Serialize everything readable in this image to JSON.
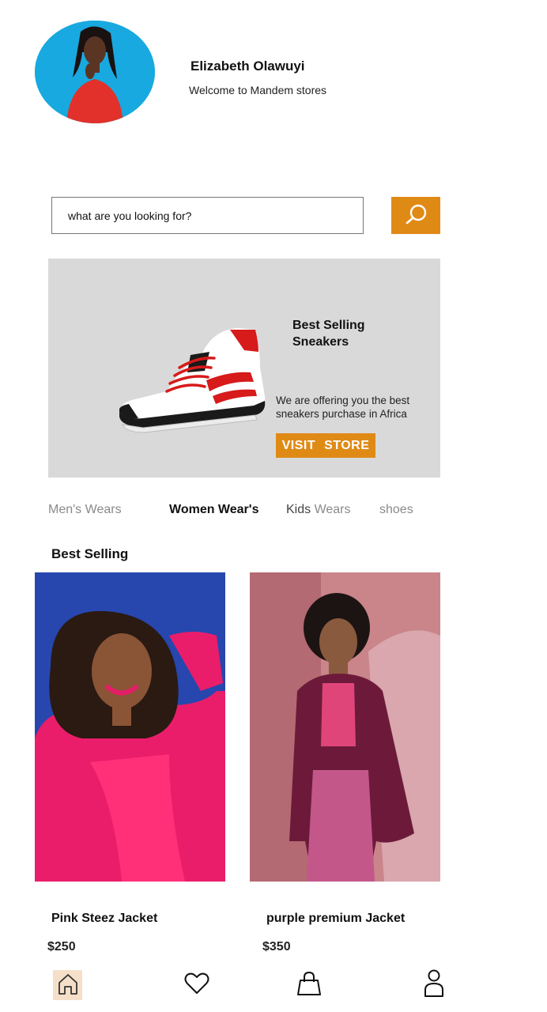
{
  "user": {
    "name": "Elizabeth Olawuyi",
    "welcome": "Welcome to Mandem stores"
  },
  "search": {
    "placeholder": "what are you looking for?",
    "icon": "search-icon"
  },
  "banner": {
    "title": "Best Selling\nSneakers",
    "text": "We are offering you the best sneakers purchase in Africa",
    "button_label": "VISIT STORE"
  },
  "categories": {
    "mens": "Men's Wears",
    "women": "Women Wear's",
    "kids_first": "Kids",
    "kids_second": " Wears",
    "shoes": "shoes",
    "active": "women"
  },
  "best_selling": {
    "title": "Best Selling",
    "products": [
      {
        "name": "Pink Steez Jacket",
        "price": "$250"
      },
      {
        "name": "purple premium Jacket",
        "price": "$350"
      }
    ]
  },
  "bottom_nav": [
    "home-icon",
    "heart-icon",
    "shopping-bag-icon",
    "user-icon"
  ],
  "colors": {
    "accent": "#e08a16",
    "banner_bg": "#d9d9d9",
    "active_nav_bg": "#f5dfc8"
  }
}
